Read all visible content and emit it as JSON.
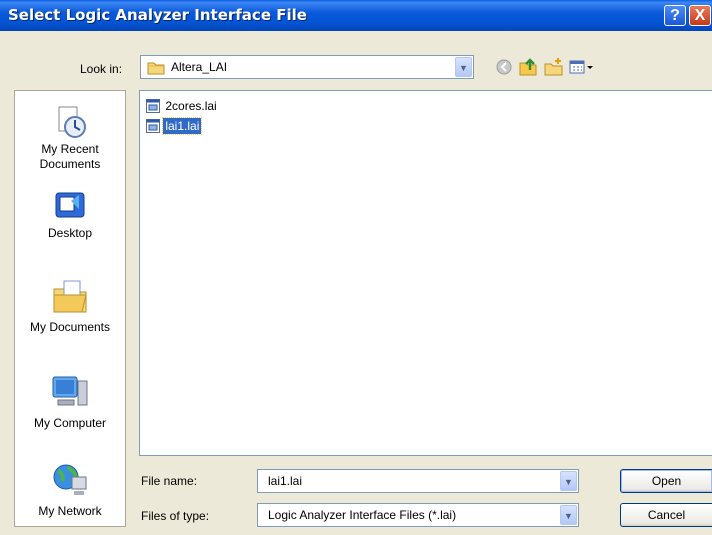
{
  "window": {
    "title": "Select Logic Analyzer Interface File",
    "help_label": "?",
    "close_label": "X"
  },
  "toolbar": {
    "lookin_label": "Look in:",
    "lookin_value": "Altera_LAI"
  },
  "places": [
    {
      "label": "My Recent Documents"
    },
    {
      "label": "Desktop"
    },
    {
      "label": "My Documents"
    },
    {
      "label": "My Computer"
    },
    {
      "label": "My Network"
    }
  ],
  "files": [
    {
      "name": "2cores.lai",
      "selected": false
    },
    {
      "name": "lai1.lai",
      "selected": true
    }
  ],
  "form": {
    "filename_label": "File name:",
    "filename_value": "lai1.lai",
    "filetype_label": "Files of type:",
    "filetype_value": "Logic Analyzer Interface Files (*.lai)"
  },
  "buttons": {
    "open": "Open",
    "cancel": "Cancel"
  }
}
